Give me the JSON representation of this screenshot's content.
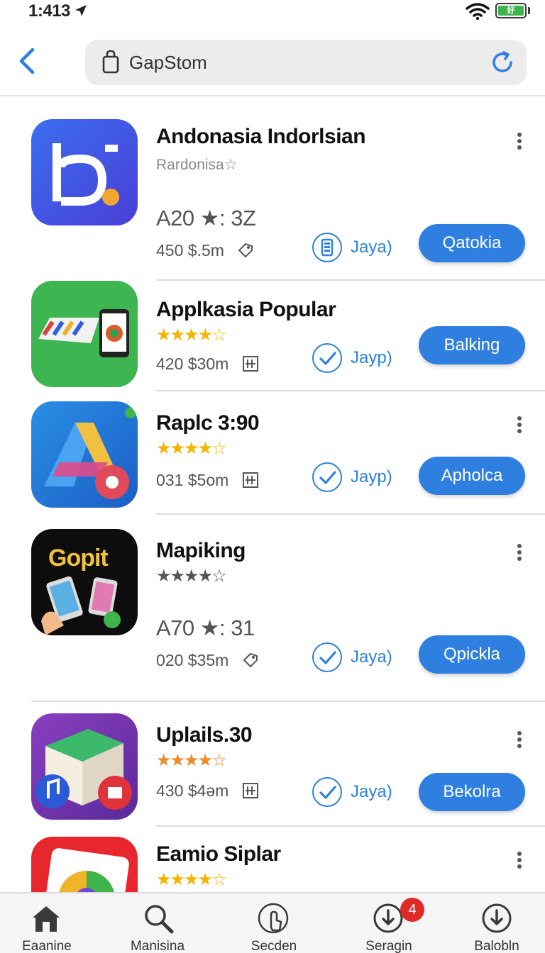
{
  "status": {
    "time": "1:413",
    "battery_label": "好"
  },
  "header": {
    "search_text": "GapStom"
  },
  "apps": [
    {
      "name": "Andonasia Indorlsian",
      "subtitle": "Rardonisa☆",
      "rating_big": "A20 ★: 3Z",
      "meta": "450  $.5m",
      "badge": "Jaya)",
      "button": "Qatokia"
    },
    {
      "name": "Applkasia Popular",
      "stars": "★★★★☆",
      "meta": "420 $30m",
      "badge": "Jayp)",
      "button": "Balking"
    },
    {
      "name": "Raplc 3:90",
      "stars": "★★★★☆",
      "meta": "031  $5om",
      "badge": "Jayp)",
      "button": "Apholca"
    },
    {
      "name": "Mapiking",
      "stars": "★★★★☆",
      "rating_big": "A70 ★: 31",
      "meta": "020 $35m",
      "badge": "Jaya)",
      "button": "Qpickla"
    },
    {
      "name": "Uplails.30",
      "stars": "★★★★☆",
      "meta": "430 $4əm",
      "badge": "Jaya)",
      "button": "Bekolra"
    },
    {
      "name": "Eamio Siplar",
      "stars": "★★★★☆"
    }
  ],
  "icon_text": {
    "gopit": "Gopit"
  },
  "tabs": [
    {
      "label": "Eaanine",
      "icon": "home-icon"
    },
    {
      "label": "Manisina",
      "icon": "search-icon"
    },
    {
      "label": "Secden",
      "icon": "touch-icon"
    },
    {
      "label": "Seragin",
      "icon": "download-icon",
      "badge": "4"
    },
    {
      "label": "Balobln",
      "icon": "download-icon"
    }
  ],
  "colors": {
    "accent": "#2e7fe0",
    "star_gold": "#f5b400",
    "badge_red": "#e02a2a"
  }
}
